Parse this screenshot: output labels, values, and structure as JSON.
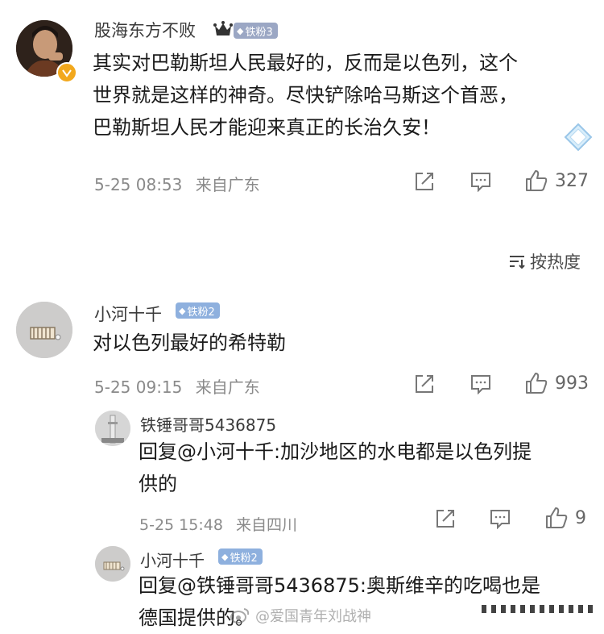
{
  "comments": [
    {
      "username": "股海东方不败",
      "badge_text": "铁粉3",
      "text_lines": [
        "其实对巴勒斯坦人民最好的，反而是以色列，这个",
        "世界就是这样的神奇。尽快铲除哈马斯这个首恶，",
        "巴勒斯坦人民才能迎来真正的长治久安！"
      ],
      "time": "5-25 08:53",
      "location": "来自广东",
      "likes": "327"
    },
    {
      "username": "小河十千",
      "badge_text": "铁粉2",
      "text_lines": [
        "对以色列最好的希特勒"
      ],
      "time": "5-25 09:15",
      "location": "来自广东",
      "likes": "993"
    },
    {
      "username": "铁锤哥哥5436875",
      "text_lines": [
        "回复@小河十千:加沙地区的水电都是以色列提",
        "供的"
      ],
      "time": "5-25 15:48",
      "location": "来自四川",
      "likes": "9"
    },
    {
      "username": "小河十千",
      "badge_text": "铁粉2",
      "text_lines": [
        "回复@铁锤哥哥5436875:奥斯维辛的吃喝也是",
        "德国提供的。"
      ]
    }
  ],
  "sort_label": "按热度",
  "watermark": "@爱国青年刘战神",
  "colors": {
    "badge": "#8eb0de",
    "badge_dark": "#9ba7c4"
  },
  "icons": [
    "verified-icon",
    "crown-icon",
    "diamond-icon",
    "share-icon",
    "comment-icon",
    "like-icon",
    "sort-icon"
  ]
}
